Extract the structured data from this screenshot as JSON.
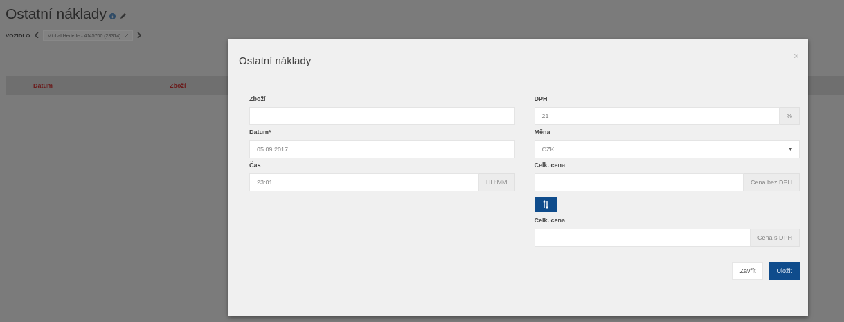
{
  "page_title": "Ostatní náklady",
  "vehicle": {
    "label": "VOZIDLO",
    "value": "Michal Hederle - 4J45700 (23314)"
  },
  "table": {
    "columns": [
      "Datum",
      "Zboží"
    ]
  },
  "modal": {
    "title": "Ostatní náklady",
    "left_fields": [
      {
        "kind": "text",
        "label": "Zboží"
      },
      {
        "kind": "text",
        "label": "Datum*",
        "value": "05.09.2017"
      },
      {
        "kind": "addon",
        "label": "Čas",
        "value": "23:01",
        "addon": "HH:MM"
      }
    ],
    "right_fields": [
      {
        "kind": "addon",
        "label": "DPH",
        "value": "21",
        "addon": "%"
      },
      {
        "kind": "select",
        "label": "Měna",
        "value": "CZK"
      },
      {
        "kind": "addon",
        "label": "Celk. cena",
        "addon": "Cena bez DPH"
      },
      {
        "kind": "swap"
      },
      {
        "kind": "addon",
        "label": "Celk. cena",
        "addon": "Cena s DPH"
      }
    ],
    "buttons": [
      {
        "kind": "default",
        "label": "Zavřít"
      },
      {
        "kind": "primary",
        "label": "Uložit"
      }
    ]
  }
}
